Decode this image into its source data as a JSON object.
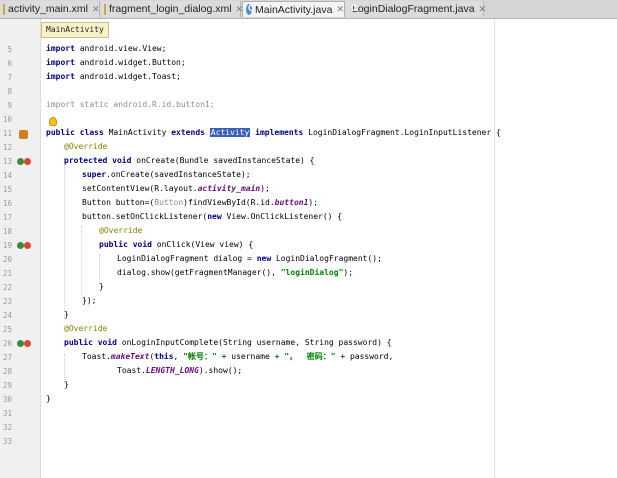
{
  "tabs": [
    {
      "label": "activity_main.xml",
      "icon": "xml-file-icon",
      "active": false
    },
    {
      "label": "fragment_login_dialog.xml",
      "icon": "xml-file-icon",
      "active": false
    },
    {
      "label": "MainActivity.java",
      "icon": "java-class-icon",
      "active": true
    },
    {
      "label": "LoginDialogFragment.java",
      "icon": "java-class-icon",
      "active": false
    }
  ],
  "breadcrumb": "MainActivity",
  "line_numbers": [
    "5",
    "6",
    "7",
    "8",
    "9",
    "10",
    "11",
    "12",
    "13",
    "14",
    "15",
    "16",
    "17",
    "18",
    "19",
    "20",
    "21",
    "22",
    "23",
    "24",
    "25",
    "26",
    "27",
    "28",
    "29",
    "30",
    "31",
    "32",
    "33"
  ],
  "code": {
    "l5": {
      "kw": "import",
      "rest": " android.view.View;"
    },
    "l6": {
      "kw": "import",
      "rest": " android.widget.Button;"
    },
    "l7": {
      "kw": "import",
      "rest": " android.widget.Toast;"
    },
    "l9": {
      "text": "import static android.R.id.button1;"
    },
    "l11": {
      "kw1": "public class",
      "name": " MainActivity ",
      "kw2": "extends",
      "sel": "Activity",
      "kw3": "implements",
      "rest": " LoginDialogFragment.LoginInputListener {"
    },
    "l12": "@Override",
    "l13": {
      "kw": "protected void",
      "rest": " onCreate(Bundle savedInstanceState) {"
    },
    "l14": {
      "kw": "super",
      "rest": ".onCreate(savedInstanceState);"
    },
    "l15": {
      "a": "setContentView(R.layout.",
      "it": "activity_main",
      "b": ");"
    },
    "l16": {
      "a": "Button button=(",
      "gr": "Button",
      "b": ")findViewById(R.id.",
      "it": "button1",
      "c": ");"
    },
    "l17": {
      "a": "button.setOnClickListener(",
      "kw": "new",
      "b": " View.OnClickListener() {"
    },
    "l18": "@Override",
    "l19": {
      "kw": "public void",
      "rest": " onClick(View view) {"
    },
    "l20": {
      "a": "LoginDialogFragment dialog = ",
      "kw": "new",
      "b": " LoginDialogFragment();"
    },
    "l21": {
      "a": "dialog.show(getFragmentManager(), ",
      "st": "\"loginDialog\"",
      "b": ");"
    },
    "l22": "}",
    "l23": "});",
    "l24": "}",
    "l25": "@Override",
    "l26": {
      "kw": "public void",
      "rest": " onLoginInputComplete(String username, String password) {"
    },
    "l27": {
      "a": "Toast.",
      "it1": "makeText",
      "b": "(",
      "kw": "this",
      "c": ", ",
      "st1": "\"帐号：\"",
      "d": " + username + ",
      "st2": "\"，  密码：\"",
      "e": " + password,"
    },
    "l28": {
      "a": "Toast.",
      "it": "LENGTH_LONG",
      "b": ").show();"
    },
    "l29": "}",
    "l30": "}"
  },
  "colors": {
    "keyword": "#000080",
    "string": "#008000",
    "annotation": "#808000",
    "selection": "#3a5fb8"
  }
}
